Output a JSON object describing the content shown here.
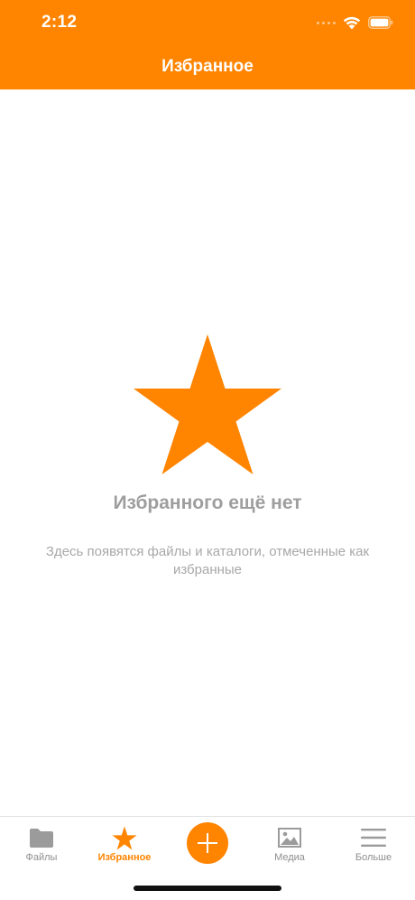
{
  "status_bar": {
    "time": "2:12"
  },
  "header": {
    "title": "Избранное"
  },
  "empty_state": {
    "icon": "star-icon",
    "title": "Избранного ещё нет",
    "description": "Здесь появятся файлы и каталоги, отмеченные как избранные"
  },
  "tabbar": {
    "items": [
      {
        "label": "Файлы",
        "icon": "folder-icon",
        "active": false
      },
      {
        "label": "Избранное",
        "icon": "star-icon",
        "active": true
      },
      {
        "label": "",
        "icon": "plus-icon",
        "active": false
      },
      {
        "label": "Медиа",
        "icon": "image-icon",
        "active": false
      },
      {
        "label": "Больше",
        "icon": "menu-icon",
        "active": false
      }
    ]
  },
  "colors": {
    "accent": "#ff8400",
    "inactive": "#8e8e8e",
    "empty_text": "#9e9e9e"
  }
}
